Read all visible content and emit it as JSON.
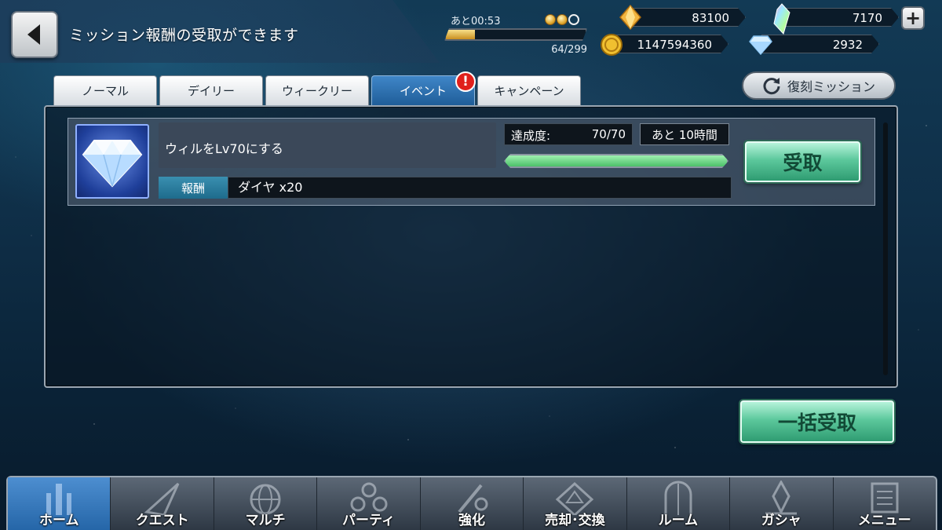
{
  "header": {
    "title": "ミッション報酬の受取ができます"
  },
  "stamina": {
    "timer": "あと00:53",
    "count": "64/299",
    "fill_fraction": 0.21,
    "orbs_full": 2,
    "orbs_total": 3
  },
  "currencies": {
    "gold_crystal": "83100",
    "rainbow_crystal": "7170",
    "coin": "1147594360",
    "diamond": "2932"
  },
  "tabs": [
    {
      "label": "ノーマル",
      "active": false
    },
    {
      "label": "デイリー",
      "active": false
    },
    {
      "label": "ウィークリー",
      "active": false
    },
    {
      "label": "イベント",
      "active": true,
      "alert": "!"
    },
    {
      "label": "キャンペーン",
      "active": false
    }
  ],
  "revival_button": "復刻ミッション",
  "mission": {
    "title": "ウィルをLv70にする",
    "progress_label": "達成度:",
    "progress_value": "70/70",
    "progress_fraction": 1.0,
    "time_left": "あと 10時間",
    "reward_label": "報酬",
    "reward_value": "ダイヤ x20",
    "claim_label": "受取"
  },
  "claim_all_label": "一括受取",
  "nav": [
    {
      "label": "ホーム",
      "icon": "home-icon",
      "active": true
    },
    {
      "label": "クエスト",
      "icon": "quest-icon",
      "active": false
    },
    {
      "label": "マルチ",
      "icon": "multi-icon",
      "active": false
    },
    {
      "label": "パーティ",
      "icon": "party-icon",
      "active": false
    },
    {
      "label": "強化",
      "icon": "enhance-icon",
      "active": false
    },
    {
      "label": "売却･交換",
      "icon": "trade-icon",
      "active": false
    },
    {
      "label": "ルーム",
      "icon": "room-icon",
      "active": false
    },
    {
      "label": "ガシャ",
      "icon": "gacha-icon",
      "active": false
    },
    {
      "label": "メニュー",
      "icon": "menu-icon",
      "active": false
    }
  ],
  "colors": {
    "active_tab": "#2f74b8",
    "claim_green": "#5cc89c",
    "alert_red": "#e0201c"
  }
}
